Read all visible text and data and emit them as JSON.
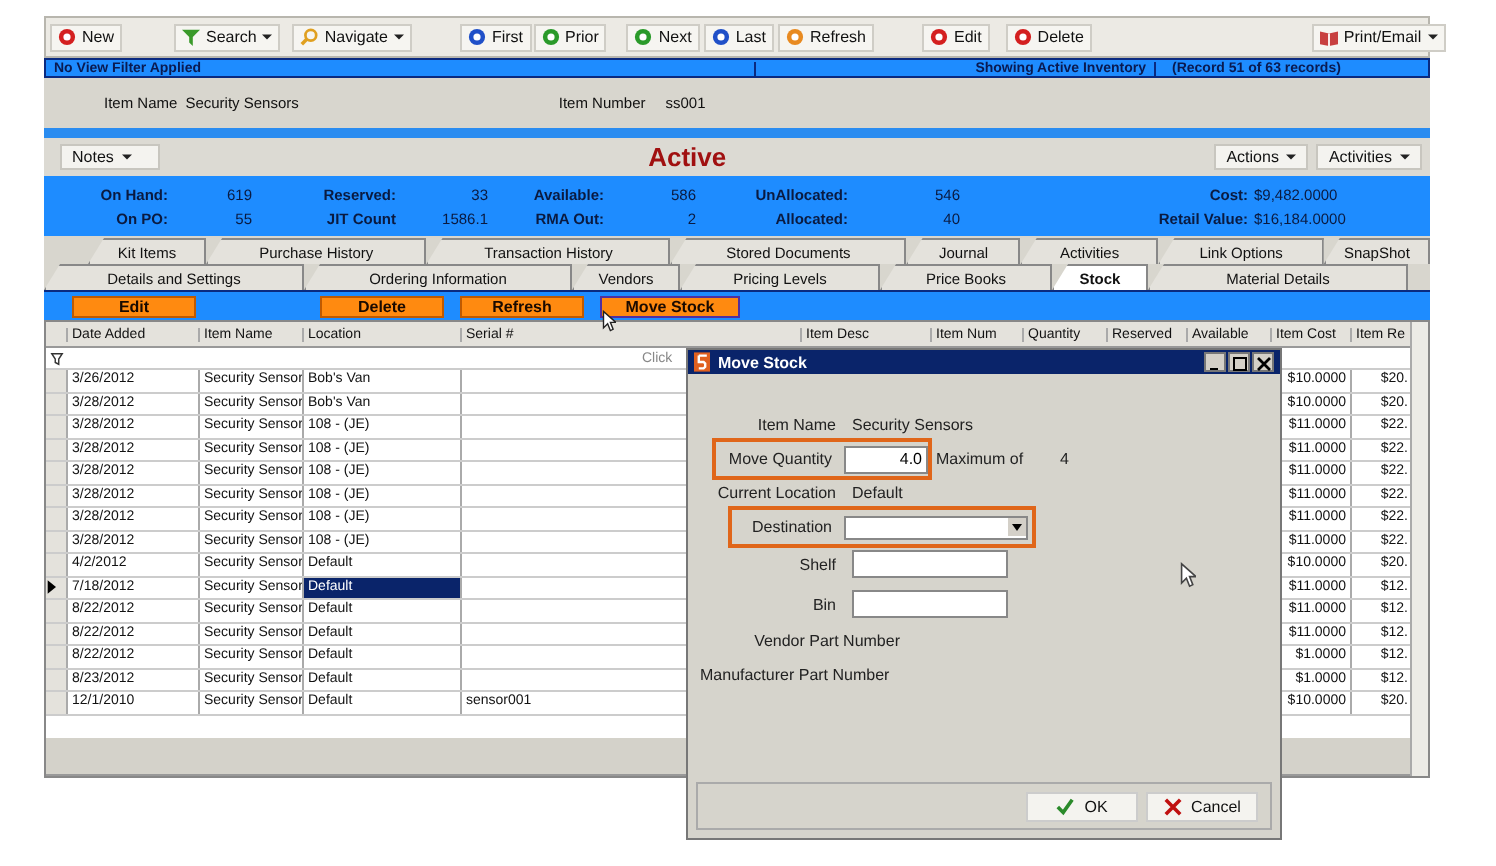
{
  "toolbar": [
    {
      "label": "New",
      "kind": "dot",
      "color": "#d42020",
      "dropdown": false
    },
    {
      "label": "Search",
      "kind": "funnel",
      "color": "#3a9a2a",
      "dropdown": true
    },
    {
      "label": "Navigate",
      "kind": "magnifier",
      "color": "#e0a020",
      "dropdown": true
    },
    {
      "label": "First",
      "kind": "dot",
      "color": "#2050c8",
      "dropdown": false
    },
    {
      "label": "Prior",
      "kind": "dot",
      "color": "#2a9a2a",
      "dropdown": false
    },
    {
      "label": "Next",
      "kind": "dot",
      "color": "#2a9a2a",
      "dropdown": false
    },
    {
      "label": "Last",
      "kind": "dot",
      "color": "#2050c8",
      "dropdown": false
    },
    {
      "label": "Refresh",
      "kind": "dot",
      "color": "#e88a20",
      "dropdown": false
    },
    {
      "label": "Edit",
      "kind": "dot",
      "color": "#d42020",
      "dropdown": false
    },
    {
      "label": "Delete",
      "kind": "dot",
      "color": "#d42020",
      "dropdown": false
    },
    {
      "label": "Print/Email",
      "kind": "book",
      "color": "#c84040",
      "dropdown": true
    }
  ],
  "filter_bar": {
    "left": "No View Filter Applied",
    "status": "Showing Active Inventory",
    "record": "(Record 51 of 63 records)"
  },
  "item": {
    "name_label": "Item Name",
    "name": "Security Sensors",
    "number_label": "Item Number",
    "number": "ss001"
  },
  "header": {
    "notes": "Notes",
    "status": "Active",
    "actions": "Actions",
    "activities": "Activities"
  },
  "stats": [
    [
      {
        "label": "On Hand:",
        "value": "619"
      },
      {
        "label": "Reserved:",
        "value": "33"
      },
      {
        "label": "Available:",
        "value": "586"
      },
      {
        "label": "UnAllocated:",
        "value": "546"
      },
      {
        "label": "Cost:",
        "value": "$9,482.0000"
      }
    ],
    [
      {
        "label": "On PO:",
        "value": "55"
      },
      {
        "label": "JIT Count",
        "value": "1586.1"
      },
      {
        "label": "RMA Out:",
        "value": "2"
      },
      {
        "label": "Allocated:",
        "value": "40"
      },
      {
        "label": "Retail Value:",
        "value": "$16,184.0000"
      }
    ]
  ],
  "tabs_back": [
    {
      "label": "Kit Items",
      "selected": false
    },
    {
      "label": "Purchase History",
      "selected": false
    },
    {
      "label": "Transaction History",
      "selected": false
    },
    {
      "label": "Stored Documents",
      "selected": false
    },
    {
      "label": "Journal",
      "selected": false
    },
    {
      "label": "Activities",
      "selected": false
    },
    {
      "label": "Link Options",
      "selected": false
    },
    {
      "label": "SnapShot",
      "selected": false
    }
  ],
  "tabs_front": [
    {
      "label": "Details and Settings",
      "selected": false
    },
    {
      "label": "Ordering Information",
      "selected": false
    },
    {
      "label": "Vendors",
      "selected": false
    },
    {
      "label": "Pricing Levels",
      "selected": false
    },
    {
      "label": "Price Books",
      "selected": false
    },
    {
      "label": "Stock",
      "selected": true
    },
    {
      "label": "Material Details",
      "selected": false
    }
  ],
  "action_buttons": [
    {
      "label": "Edit",
      "hovered": false
    },
    {
      "label": "Delete",
      "hovered": false
    },
    {
      "label": "Refresh",
      "hovered": false
    },
    {
      "label": "Move Stock",
      "hovered": true
    }
  ],
  "table": {
    "columns": [
      "Date Added",
      "Item Name",
      "Location",
      "Serial #",
      "Item Desc",
      "Item Num",
      "Quantity",
      "Reserved",
      "Available",
      "Item Cost",
      "Item Re"
    ],
    "filter_hint": "Click",
    "rows": [
      {
        "date": "3/26/2012",
        "item": "Security Sensor",
        "location": "Bob's Van",
        "serial": "",
        "cost": "$10.0000",
        "retail": "$20.",
        "selected": false
      },
      {
        "date": "3/28/2012",
        "item": "Security Sensor",
        "location": "Bob's Van",
        "serial": "",
        "cost": "$10.0000",
        "retail": "$20.",
        "selected": false
      },
      {
        "date": "3/28/2012",
        "item": "Security Sensor",
        "location": "108 - (JE)",
        "serial": "",
        "cost": "$11.0000",
        "retail": "$22.",
        "selected": false
      },
      {
        "date": "3/28/2012",
        "item": "Security Sensor",
        "location": "108 - (JE)",
        "serial": "",
        "cost": "$11.0000",
        "retail": "$22.",
        "selected": false
      },
      {
        "date": "3/28/2012",
        "item": "Security Sensor",
        "location": "108 - (JE)",
        "serial": "",
        "cost": "$11.0000",
        "retail": "$22.",
        "selected": false
      },
      {
        "date": "3/28/2012",
        "item": "Security Sensor",
        "location": "108 - (JE)",
        "serial": "",
        "cost": "$11.0000",
        "retail": "$22.",
        "selected": false
      },
      {
        "date": "3/28/2012",
        "item": "Security Sensor",
        "location": "108 - (JE)",
        "serial": "",
        "cost": "$11.0000",
        "retail": "$22.",
        "selected": false
      },
      {
        "date": "3/28/2012",
        "item": "Security Sensor",
        "location": "108 - (JE)",
        "serial": "",
        "cost": "$11.0000",
        "retail": "$22.",
        "selected": false
      },
      {
        "date": "4/2/2012",
        "item": "Security Sensor",
        "location": "Default",
        "serial": "",
        "cost": "$10.0000",
        "retail": "$20.",
        "selected": false
      },
      {
        "date": "7/18/2012",
        "item": "Security Sensor",
        "location": "Default",
        "serial": "",
        "cost": "$11.0000",
        "retail": "$12.",
        "selected": true
      },
      {
        "date": "8/22/2012",
        "item": "Security Sensor",
        "location": "Default",
        "serial": "",
        "cost": "$11.0000",
        "retail": "$12.",
        "selected": false
      },
      {
        "date": "8/22/2012",
        "item": "Security Sensor",
        "location": "Default",
        "serial": "",
        "cost": "$11.0000",
        "retail": "$12.",
        "selected": false
      },
      {
        "date": "8/22/2012",
        "item": "Security Sensor",
        "location": "Default",
        "serial": "",
        "cost": "$1.0000",
        "retail": "$12.",
        "selected": false
      },
      {
        "date": "8/23/2012",
        "item": "Security Sensor",
        "location": "Default",
        "serial": "",
        "cost": "$1.0000",
        "retail": "$12.",
        "selected": false
      },
      {
        "date": "12/1/2010",
        "item": "Security Sensor",
        "location": "Default",
        "serial": "sensor001",
        "cost": "$10.0000",
        "retail": "$20.",
        "selected": false
      }
    ]
  },
  "dialog": {
    "title": "Move Stock",
    "item_name_label": "Item Name",
    "item_name": "Security Sensors",
    "quantity_label": "Move Quantity",
    "quantity": "4.0",
    "quantity_highlighted": true,
    "maximum_label": "Maximum of",
    "maximum": "4",
    "location_label": "Current Location",
    "location": "Default",
    "destination_label": "Destination",
    "destination_highlighted": true,
    "shelf_label": "Shelf",
    "bin_label": "Bin",
    "vendor_part_label": "Vendor Part Number",
    "manufacturer_part_label": "Manufacturer Part Number",
    "ok": "OK",
    "cancel": "Cancel"
  }
}
